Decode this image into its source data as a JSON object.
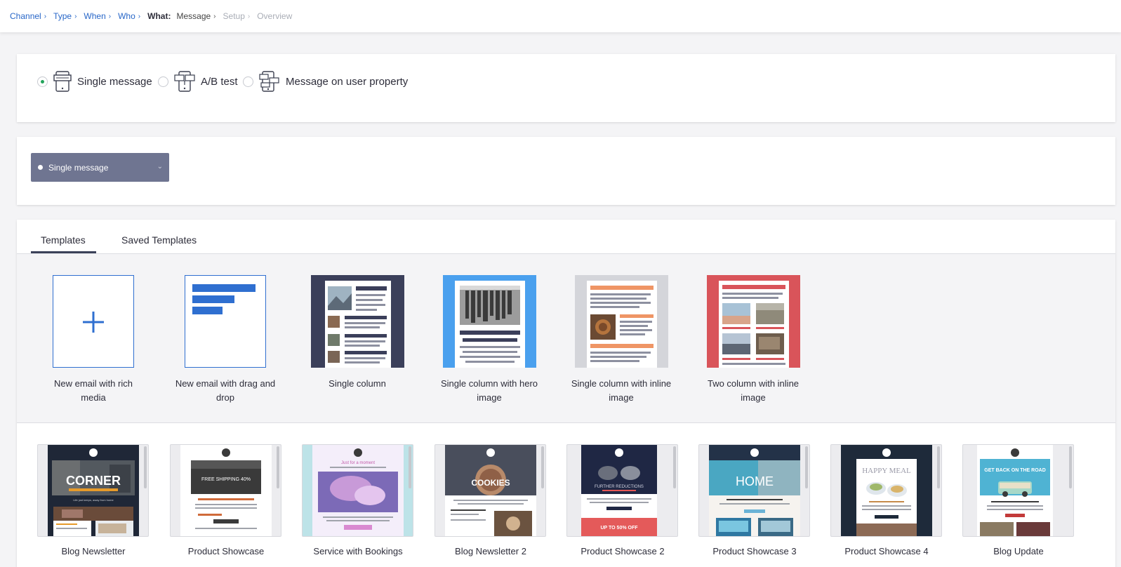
{
  "breadcrumb": {
    "items": [
      {
        "label": "Channel"
      },
      {
        "label": "Type"
      },
      {
        "label": "When"
      },
      {
        "label": "Who"
      }
    ],
    "current": {
      "key": "What:",
      "label": "Message"
    },
    "upcoming": [
      {
        "label": "Setup"
      },
      {
        "label": "Overview"
      }
    ]
  },
  "message_type": {
    "options": [
      {
        "label": "Single message",
        "selected": true
      },
      {
        "label": "A/B test",
        "selected": false
      },
      {
        "label": "Message on user property",
        "selected": false
      }
    ]
  },
  "variant_dropdown": {
    "label": "Single message"
  },
  "tabs": [
    {
      "label": "Templates",
      "active": true
    },
    {
      "label": "Saved Templates",
      "active": false
    }
  ],
  "templates": [
    {
      "label": "New email with rich media",
      "icon": "plus-icon"
    },
    {
      "label": "New email with drag and drop",
      "icon": "drag-drop-icon"
    },
    {
      "label": "Single column",
      "icon": "single-column-layout"
    },
    {
      "label": "Single column with hero image",
      "icon": "hero-image-layout"
    },
    {
      "label": "Single column with inline image",
      "icon": "inline-image-layout"
    },
    {
      "label": "Two column with inline image",
      "icon": "two-column-layout"
    }
  ],
  "gallery": [
    {
      "label": "Blog Newsletter",
      "headline": "CORNER",
      "caption": "Life just keeps, away from home"
    },
    {
      "label": "Product Showcase",
      "headline": "FREE SHIPPING 40%",
      "caption": ""
    },
    {
      "label": "Service with Bookings",
      "headline": "Just for a moment",
      "caption": ""
    },
    {
      "label": "Blog Newsletter 2",
      "headline": "COOKIES",
      "caption": ""
    },
    {
      "label": "Product Showcase 2",
      "headline": "FURTHER REDUCTIONS",
      "caption": "UP TO 50% OFF"
    },
    {
      "label": "Product Showcase 3",
      "headline": "HOME",
      "caption": ""
    },
    {
      "label": "Product Showcase 4",
      "headline": "HAPPY MEAL",
      "caption": ""
    },
    {
      "label": "Blog Update",
      "headline": "GET BACK ON THE ROAD",
      "caption": ""
    }
  ],
  "colors": {
    "link": "#2867c8",
    "select_green": "#22a35b",
    "dropdown_bg": "#6f7591",
    "tab_indicator": "#3b4159"
  }
}
